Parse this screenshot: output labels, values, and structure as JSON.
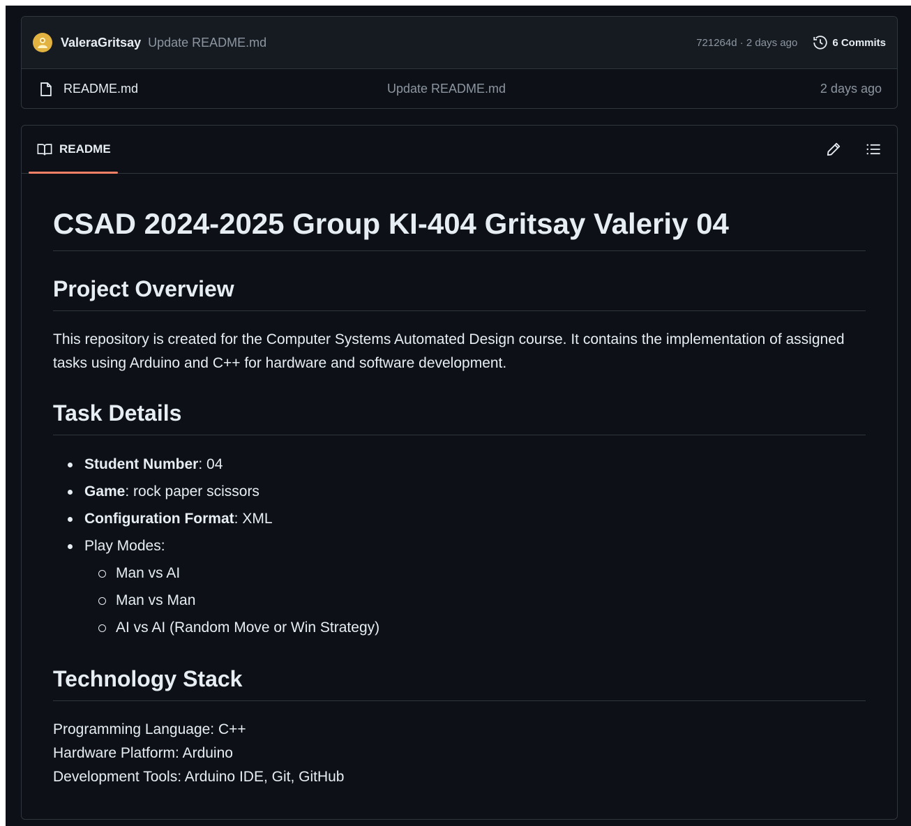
{
  "commit": {
    "author": "ValeraGritsay",
    "message": "Update README.md",
    "sha_date": "721264d · 2 days ago",
    "commits_label": "6 Commits"
  },
  "files": [
    {
      "name": "README.md",
      "message": "Update README.md",
      "date": "2 days ago"
    }
  ],
  "readme": {
    "tab_label": "README",
    "title": "CSAD 2024-2025 Group KI-404 Gritsay Valeriy 04",
    "overview_heading": "Project Overview",
    "overview_text": "This repository is created for the Computer Systems Automated Design course. It contains the implementation of assigned tasks using Arduino and C++ for hardware and software development.",
    "task_heading": "Task Details",
    "task_items": [
      {
        "label": "Student Number",
        "value": ": 04"
      },
      {
        "label": "Game",
        "value": ": rock paper scissors"
      },
      {
        "label": "Configuration Format",
        "value": ": XML"
      }
    ],
    "play_modes_label": "Play Modes:",
    "play_modes": [
      "Man vs AI",
      "Man vs Man",
      "AI vs AI (Random Move or Win Strategy)"
    ],
    "tech_heading": "Technology Stack",
    "tech_lines": [
      "Programming Language: C++",
      "Hardware Platform: Arduino",
      "Development Tools: Arduino IDE, Git, GitHub"
    ]
  },
  "icons": {
    "avatar": "avatar",
    "history": "history-icon",
    "file": "file-icon",
    "book": "book-icon",
    "edit": "pencil-icon",
    "outline": "list-icon"
  }
}
